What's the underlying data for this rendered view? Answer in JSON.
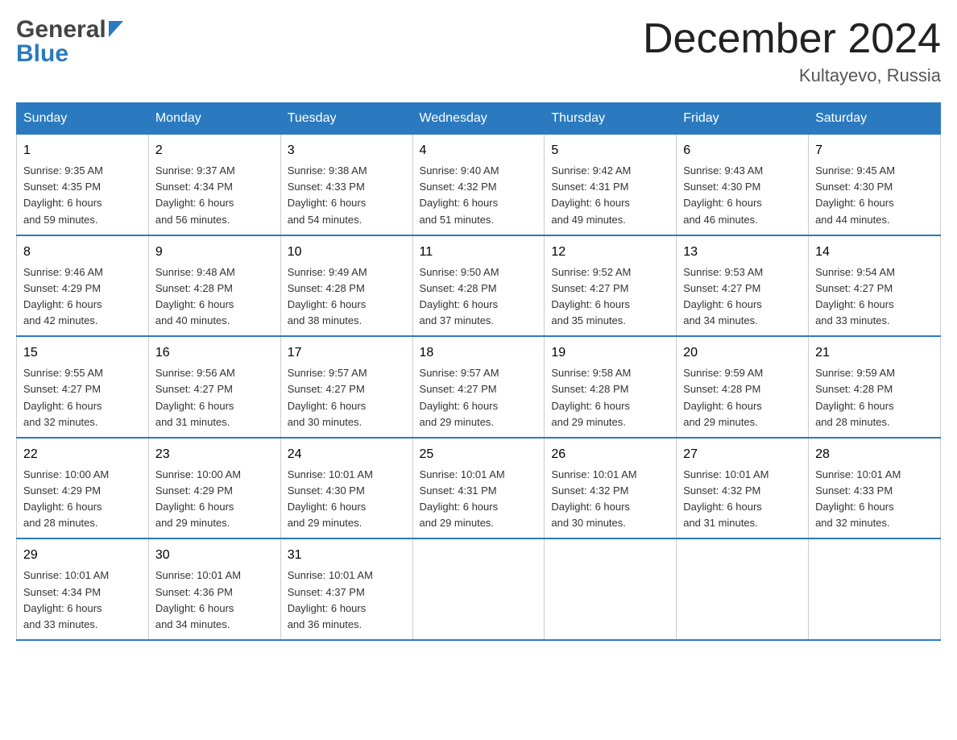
{
  "header": {
    "logo_general": "General",
    "logo_blue": "Blue",
    "month_title": "December 2024",
    "location": "Kultayevo, Russia"
  },
  "days_of_week": [
    "Sunday",
    "Monday",
    "Tuesday",
    "Wednesday",
    "Thursday",
    "Friday",
    "Saturday"
  ],
  "weeks": [
    [
      {
        "day": "1",
        "sunrise": "9:35 AM",
        "sunset": "4:35 PM",
        "daylight": "6 hours and 59 minutes."
      },
      {
        "day": "2",
        "sunrise": "9:37 AM",
        "sunset": "4:34 PM",
        "daylight": "6 hours and 56 minutes."
      },
      {
        "day": "3",
        "sunrise": "9:38 AM",
        "sunset": "4:33 PM",
        "daylight": "6 hours and 54 minutes."
      },
      {
        "day": "4",
        "sunrise": "9:40 AM",
        "sunset": "4:32 PM",
        "daylight": "6 hours and 51 minutes."
      },
      {
        "day": "5",
        "sunrise": "9:42 AM",
        "sunset": "4:31 PM",
        "daylight": "6 hours and 49 minutes."
      },
      {
        "day": "6",
        "sunrise": "9:43 AM",
        "sunset": "4:30 PM",
        "daylight": "6 hours and 46 minutes."
      },
      {
        "day": "7",
        "sunrise": "9:45 AM",
        "sunset": "4:30 PM",
        "daylight": "6 hours and 44 minutes."
      }
    ],
    [
      {
        "day": "8",
        "sunrise": "9:46 AM",
        "sunset": "4:29 PM",
        "daylight": "6 hours and 42 minutes."
      },
      {
        "day": "9",
        "sunrise": "9:48 AM",
        "sunset": "4:28 PM",
        "daylight": "6 hours and 40 minutes."
      },
      {
        "day": "10",
        "sunrise": "9:49 AM",
        "sunset": "4:28 PM",
        "daylight": "6 hours and 38 minutes."
      },
      {
        "day": "11",
        "sunrise": "9:50 AM",
        "sunset": "4:28 PM",
        "daylight": "6 hours and 37 minutes."
      },
      {
        "day": "12",
        "sunrise": "9:52 AM",
        "sunset": "4:27 PM",
        "daylight": "6 hours and 35 minutes."
      },
      {
        "day": "13",
        "sunrise": "9:53 AM",
        "sunset": "4:27 PM",
        "daylight": "6 hours and 34 minutes."
      },
      {
        "day": "14",
        "sunrise": "9:54 AM",
        "sunset": "4:27 PM",
        "daylight": "6 hours and 33 minutes."
      }
    ],
    [
      {
        "day": "15",
        "sunrise": "9:55 AM",
        "sunset": "4:27 PM",
        "daylight": "6 hours and 32 minutes."
      },
      {
        "day": "16",
        "sunrise": "9:56 AM",
        "sunset": "4:27 PM",
        "daylight": "6 hours and 31 minutes."
      },
      {
        "day": "17",
        "sunrise": "9:57 AM",
        "sunset": "4:27 PM",
        "daylight": "6 hours and 30 minutes."
      },
      {
        "day": "18",
        "sunrise": "9:57 AM",
        "sunset": "4:27 PM",
        "daylight": "6 hours and 29 minutes."
      },
      {
        "day": "19",
        "sunrise": "9:58 AM",
        "sunset": "4:28 PM",
        "daylight": "6 hours and 29 minutes."
      },
      {
        "day": "20",
        "sunrise": "9:59 AM",
        "sunset": "4:28 PM",
        "daylight": "6 hours and 29 minutes."
      },
      {
        "day": "21",
        "sunrise": "9:59 AM",
        "sunset": "4:28 PM",
        "daylight": "6 hours and 28 minutes."
      }
    ],
    [
      {
        "day": "22",
        "sunrise": "10:00 AM",
        "sunset": "4:29 PM",
        "daylight": "6 hours and 28 minutes."
      },
      {
        "day": "23",
        "sunrise": "10:00 AM",
        "sunset": "4:29 PM",
        "daylight": "6 hours and 29 minutes."
      },
      {
        "day": "24",
        "sunrise": "10:01 AM",
        "sunset": "4:30 PM",
        "daylight": "6 hours and 29 minutes."
      },
      {
        "day": "25",
        "sunrise": "10:01 AM",
        "sunset": "4:31 PM",
        "daylight": "6 hours and 29 minutes."
      },
      {
        "day": "26",
        "sunrise": "10:01 AM",
        "sunset": "4:32 PM",
        "daylight": "6 hours and 30 minutes."
      },
      {
        "day": "27",
        "sunrise": "10:01 AM",
        "sunset": "4:32 PM",
        "daylight": "6 hours and 31 minutes."
      },
      {
        "day": "28",
        "sunrise": "10:01 AM",
        "sunset": "4:33 PM",
        "daylight": "6 hours and 32 minutes."
      }
    ],
    [
      {
        "day": "29",
        "sunrise": "10:01 AM",
        "sunset": "4:34 PM",
        "daylight": "6 hours and 33 minutes."
      },
      {
        "day": "30",
        "sunrise": "10:01 AM",
        "sunset": "4:36 PM",
        "daylight": "6 hours and 34 minutes."
      },
      {
        "day": "31",
        "sunrise": "10:01 AM",
        "sunset": "4:37 PM",
        "daylight": "6 hours and 36 minutes."
      },
      null,
      null,
      null,
      null
    ]
  ],
  "labels": {
    "sunrise": "Sunrise:",
    "sunset": "Sunset:",
    "daylight": "Daylight:"
  }
}
